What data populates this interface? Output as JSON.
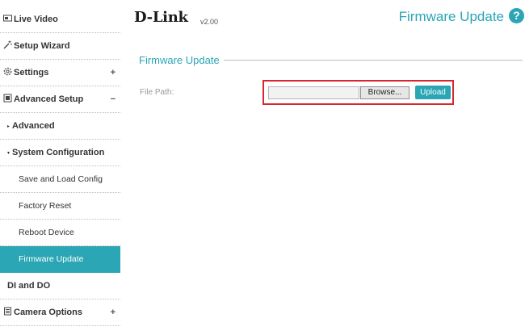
{
  "header": {
    "logo_text": "D-Link",
    "version": "v2.00",
    "page_title": "Firmware Update",
    "help_glyph": "?"
  },
  "sidebar": {
    "items": [
      {
        "label": "Live Video",
        "icon": "video-icon"
      },
      {
        "label": "Setup Wizard",
        "icon": "wand-icon"
      },
      {
        "label": "Settings",
        "icon": "gear-icon",
        "expander": "+"
      },
      {
        "label": "Advanced Setup",
        "icon": "advanced-setup-icon",
        "expander": "−"
      },
      {
        "label": "Advanced",
        "bullet": "▸"
      },
      {
        "label": "System Configuration",
        "bullet": "▾"
      },
      {
        "label": "Save and Load Config"
      },
      {
        "label": "Factory Reset"
      },
      {
        "label": "Reboot Device"
      },
      {
        "label": "Firmware Update",
        "active": true
      },
      {
        "label": "DI and DO"
      },
      {
        "label": "Camera Options",
        "icon": "camera-options-icon",
        "expander": "+"
      }
    ]
  },
  "main": {
    "section_title": "Firmware Update",
    "file_path_label": "File Path:",
    "file_input_value": "",
    "browse_label": "Browse...",
    "upload_label": "Upload"
  },
  "colors": {
    "accent": "#2aa6b5",
    "highlight_border": "#d7262e",
    "active_item_bg": "#2aa6b5"
  }
}
